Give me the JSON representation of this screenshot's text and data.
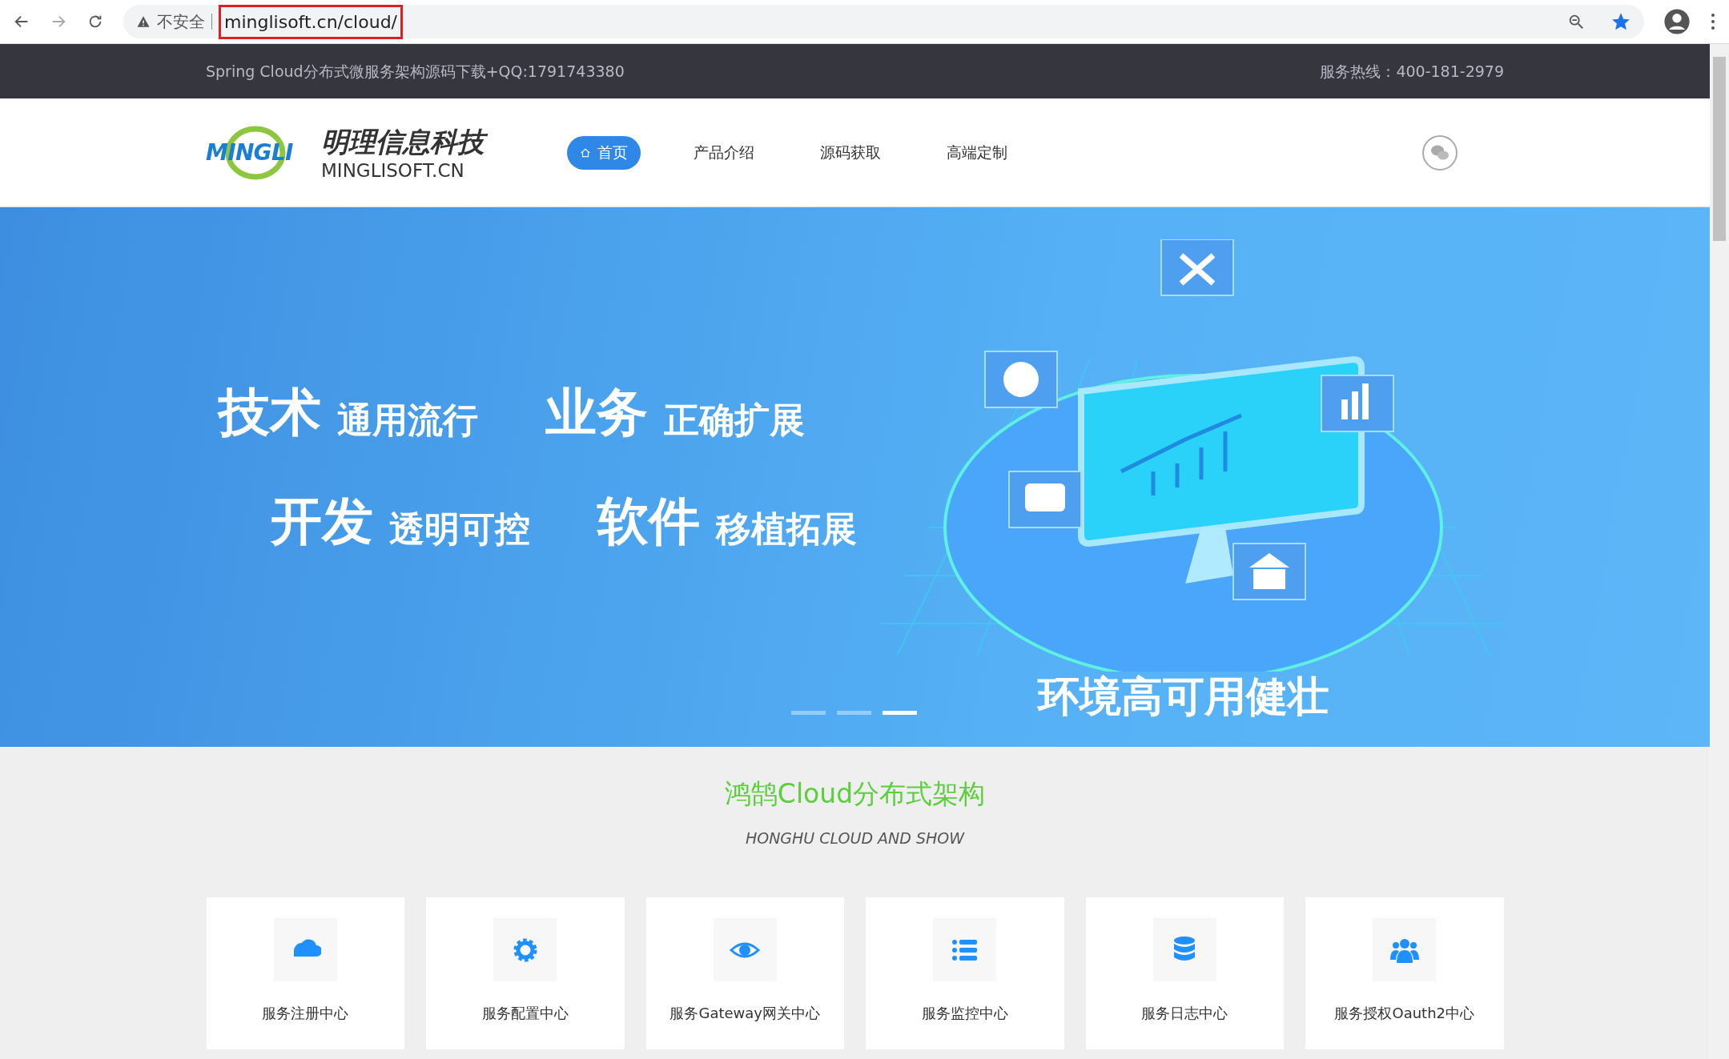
{
  "browser": {
    "security_label": "不安全",
    "url": "minglisoft.cn/cloud/"
  },
  "top_bar": {
    "left_text": "Spring Cloud分布式微服务架构源码下载+QQ:1791743380",
    "right_text": "服务热线：400-181-2979"
  },
  "header": {
    "logo_text": "MINGLI",
    "brand_name": "明理信息科技",
    "brand_domain": "MINGLISOFT.CN",
    "nav": [
      {
        "label": "首页",
        "selected": true
      },
      {
        "label": "产品介绍",
        "selected": false
      },
      {
        "label": "源码获取",
        "selected": false
      },
      {
        "label": "高端定制",
        "selected": false
      }
    ]
  },
  "banner": {
    "slogans": [
      [
        {
          "big": "技术",
          "small": "通用流行"
        },
        {
          "big": "业务",
          "small": "正确扩展"
        }
      ],
      [
        {
          "big": "开发",
          "small": "透明可控"
        },
        {
          "big": "软件",
          "small": "移植拓展"
        }
      ]
    ],
    "caption": "环境高可用健壮",
    "slides": [
      {
        "selected": false
      },
      {
        "selected": false
      },
      {
        "selected": true
      }
    ]
  },
  "section": {
    "title": "鸿鹄Cloud分布式架构",
    "subtitle": "HONGHU CLOUD AND SHOW",
    "cards": [
      {
        "kind": "cloud",
        "label": "服务注册中心"
      },
      {
        "kind": "gear",
        "label": "服务配置中心"
      },
      {
        "kind": "eye",
        "label": "服务Gateway网关中心"
      },
      {
        "kind": "list",
        "label": "服务监控中心"
      },
      {
        "kind": "database",
        "label": "服务日志中心"
      },
      {
        "kind": "users",
        "label": "服务授权Oauth2中心"
      }
    ]
  }
}
